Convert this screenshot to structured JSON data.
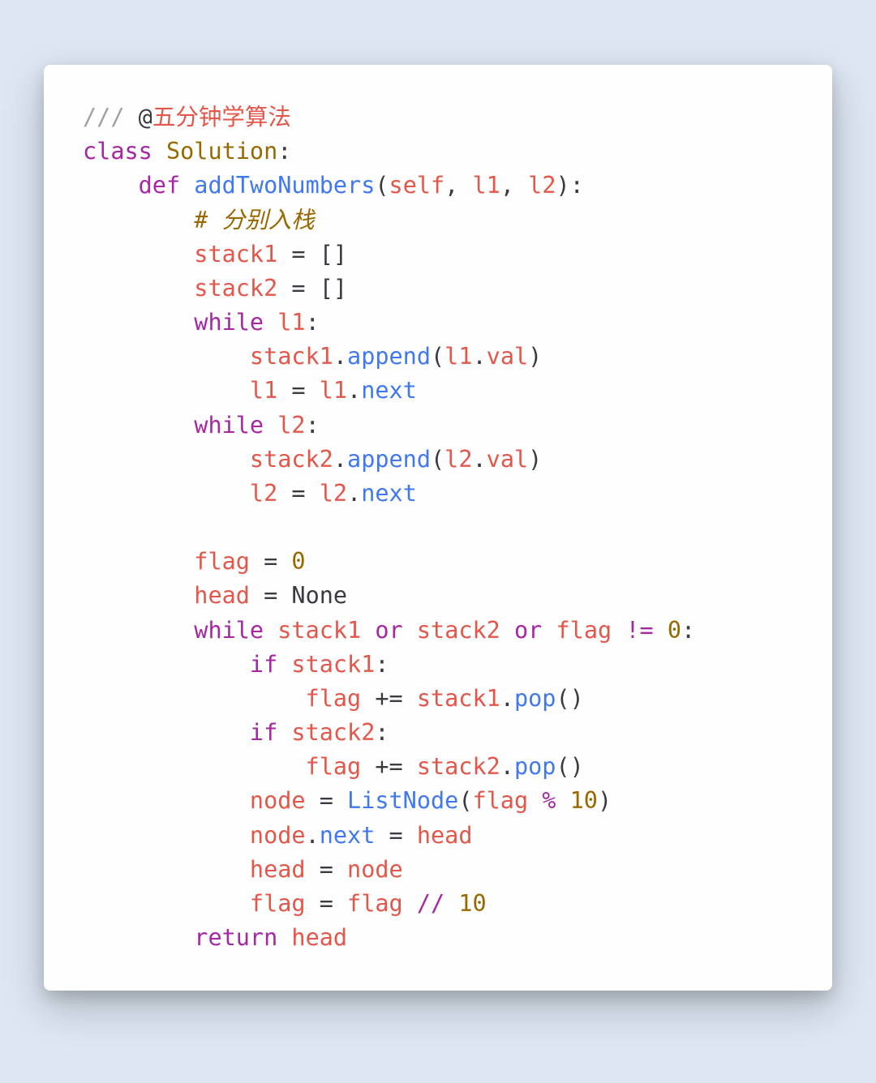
{
  "t": {
    "triple_slash": "/// ",
    "at": "@",
    "author": "五分钟学算法",
    "class_kw": "class",
    "class_name": "Solution",
    "colon": ":",
    "def_kw": "def",
    "func_name": "addTwoNumbers",
    "lparen": "(",
    "rparen": ")",
    "comma_sp": ", ",
    "self_kw": "self",
    "l1": "l1",
    "l2": "l2",
    "comment1": "# 分别入栈",
    "stack1": "stack1",
    "stack2": "stack2",
    "eq_sp": " = ",
    "brackets": "[]",
    "while_kw": "while",
    "dot": ".",
    "append": "append",
    "val": "val",
    "next": "next",
    "flag": "flag",
    "zero": "0",
    "head": "head",
    "none": "None",
    "or_kw": "or",
    "neq": "!=",
    "if_kw": "if",
    "plus_eq_sp": " += ",
    "pop": "pop",
    "node": "node",
    "listnode": "ListNode",
    "percent": "%",
    "ten": "10",
    "floordiv": "//",
    "return_kw": "return"
  }
}
